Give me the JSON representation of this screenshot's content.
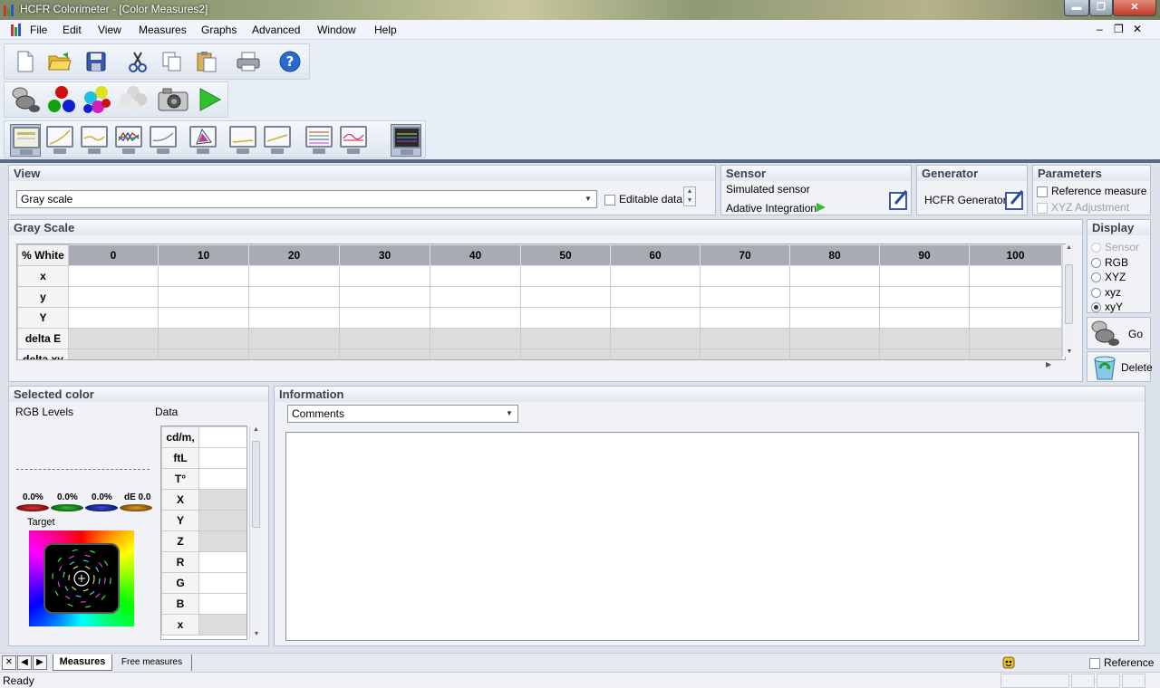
{
  "window": {
    "title": "HCFR Colorimeter - [Color Measures2]",
    "controls": {
      "minimize": "▬",
      "restore": "❐",
      "close": "✕"
    }
  },
  "menu": {
    "items": [
      "File",
      "Edit",
      "View",
      "Measures",
      "Graphs",
      "Advanced",
      "Window",
      "Help"
    ],
    "mdi": {
      "minimize": "–",
      "restore": "❐",
      "close": "✕"
    }
  },
  "view_panel": {
    "title": "View",
    "selected_view": "Gray scale",
    "editable_label": "Editable data"
  },
  "sensor_panel": {
    "title": "Sensor",
    "name": "Simulated sensor",
    "integration": "Adative Integration"
  },
  "generator_panel": {
    "title": "Generator",
    "name": "HCFR Generator"
  },
  "parameters_panel": {
    "title": "Parameters",
    "reference_measure": "Reference measure",
    "xyz_adjustment": "XYZ Adjustment"
  },
  "grayscale_panel": {
    "title": "Gray Scale",
    "corner": "% White",
    "columns": [
      "0",
      "10",
      "20",
      "30",
      "40",
      "50",
      "60",
      "70",
      "80",
      "90",
      "100"
    ],
    "rows": [
      {
        "label": "x",
        "gray": false
      },
      {
        "label": "y",
        "gray": false
      },
      {
        "label": "Y",
        "gray": false
      },
      {
        "label": "delta E",
        "gray": true
      },
      {
        "label": "delta xy",
        "gray": true
      }
    ]
  },
  "display_panel": {
    "title": "Display",
    "options": [
      "Sensor",
      "RGB",
      "XYZ",
      "xyz",
      "xyY"
    ],
    "selected": "xyY",
    "go_label": "Go",
    "delete_label": "Delete"
  },
  "selected_color": {
    "title": "Selected color",
    "rgb_levels": "RGB Levels",
    "data_label": "Data",
    "r": "0.0%",
    "g": "0.0%",
    "b": "0.0%",
    "de": "dE 0.0",
    "target_label": "Target",
    "data_rows": [
      "cd/m,",
      "ftL",
      "T°",
      "X",
      "Y",
      "Z",
      "R",
      "G",
      "B",
      "x"
    ]
  },
  "information": {
    "title": "Information",
    "selected": "Comments"
  },
  "tabs": {
    "active": "Measures",
    "other": "Free measures",
    "nav": [
      "✕",
      "◀",
      "▶"
    ]
  },
  "status": {
    "text": "Ready",
    "reference_label": "Reference"
  }
}
